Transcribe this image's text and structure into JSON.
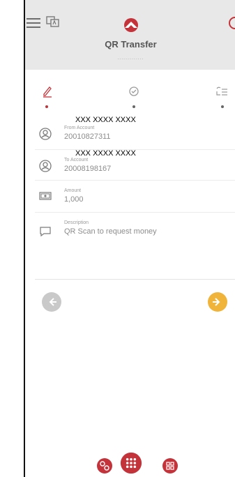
{
  "header": {
    "title": "QR Transfer",
    "subtitle": "............."
  },
  "steps": [
    {
      "name": "edit",
      "active": true
    },
    {
      "name": "confirm",
      "active": false
    },
    {
      "name": "review",
      "active": false
    }
  ],
  "form": {
    "from": {
      "masked_name": "XXX XXXX XXXX",
      "caption": "From Account",
      "value": "20010827311"
    },
    "to": {
      "masked_name": "XXX XXXX XXXX",
      "caption": "To Account",
      "value": "20008198167"
    },
    "amount": {
      "caption": "Amount",
      "value": "1,000"
    },
    "description": {
      "caption": "Description",
      "value": "QR Scan to request money"
    }
  },
  "colors": {
    "brand": "#c4333a",
    "next": "#f0b43a",
    "prev": "#c9c9c9"
  },
  "icons": [
    "menu-icon",
    "translate-icon",
    "logo-icon",
    "pencil-icon",
    "check-badge-icon",
    "list-icon",
    "user-icon",
    "money-icon",
    "chat-icon",
    "arrow-left-icon",
    "arrow-right-icon",
    "scan-icon",
    "grid-icon",
    "qr-icon"
  ]
}
